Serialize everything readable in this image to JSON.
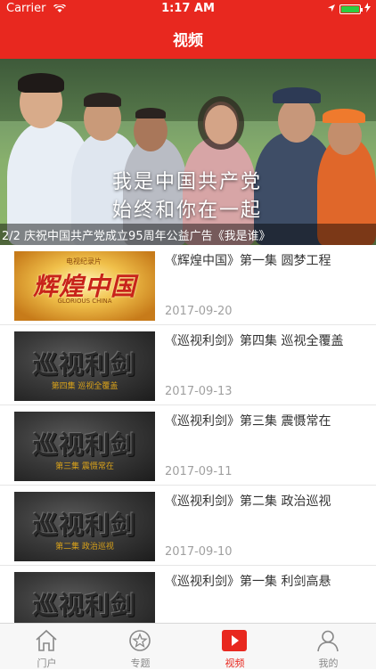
{
  "status_bar": {
    "carrier": "Carrier",
    "time": "1:17 AM"
  },
  "header": {
    "title": "视频"
  },
  "banner": {
    "slogan_line1": "我是中国共产党",
    "slogan_line2": "始终和你在一起",
    "caption": "2/2  庆祝中国共产党成立95周年公益广告《我是谁》"
  },
  "videos": [
    {
      "title": "《辉煌中国》第一集 圆梦工程",
      "date": "2017-09-20",
      "thumb_text": "辉煌中国",
      "thumb_top": "电视纪录片",
      "thumb_sub": "GLORIOUS CHINA",
      "thumb_style": "gold"
    },
    {
      "title": "《巡视利剑》第四集 巡视全覆盖",
      "date": "2017-09-13",
      "thumb_text": "巡视利剑",
      "thumb_sub": "第四集 巡视全覆盖",
      "thumb_style": "rock"
    },
    {
      "title": "《巡视利剑》第三集 震慑常在",
      "date": "2017-09-11",
      "thumb_text": "巡视利剑",
      "thumb_sub": "第三集 震慑常在",
      "thumb_style": "rock"
    },
    {
      "title": "《巡视利剑》第二集 政治巡视",
      "date": "2017-09-10",
      "thumb_text": "巡视利剑",
      "thumb_sub": "第二集 政治巡视",
      "thumb_style": "rock"
    },
    {
      "title": "《巡视利剑》第一集 利剑高悬",
      "date": "",
      "thumb_text": "巡视利剑",
      "thumb_sub": "",
      "thumb_style": "rock"
    }
  ],
  "tabs": [
    {
      "label": "门户",
      "icon": "home-icon",
      "active": false
    },
    {
      "label": "专题",
      "icon": "star-icon",
      "active": false
    },
    {
      "label": "视频",
      "icon": "play-icon",
      "active": true
    },
    {
      "label": "我的",
      "icon": "user-icon",
      "active": false
    }
  ],
  "colors": {
    "brand": "#e8281f",
    "tab_inactive": "#888888",
    "date": "#a0a0a0"
  }
}
